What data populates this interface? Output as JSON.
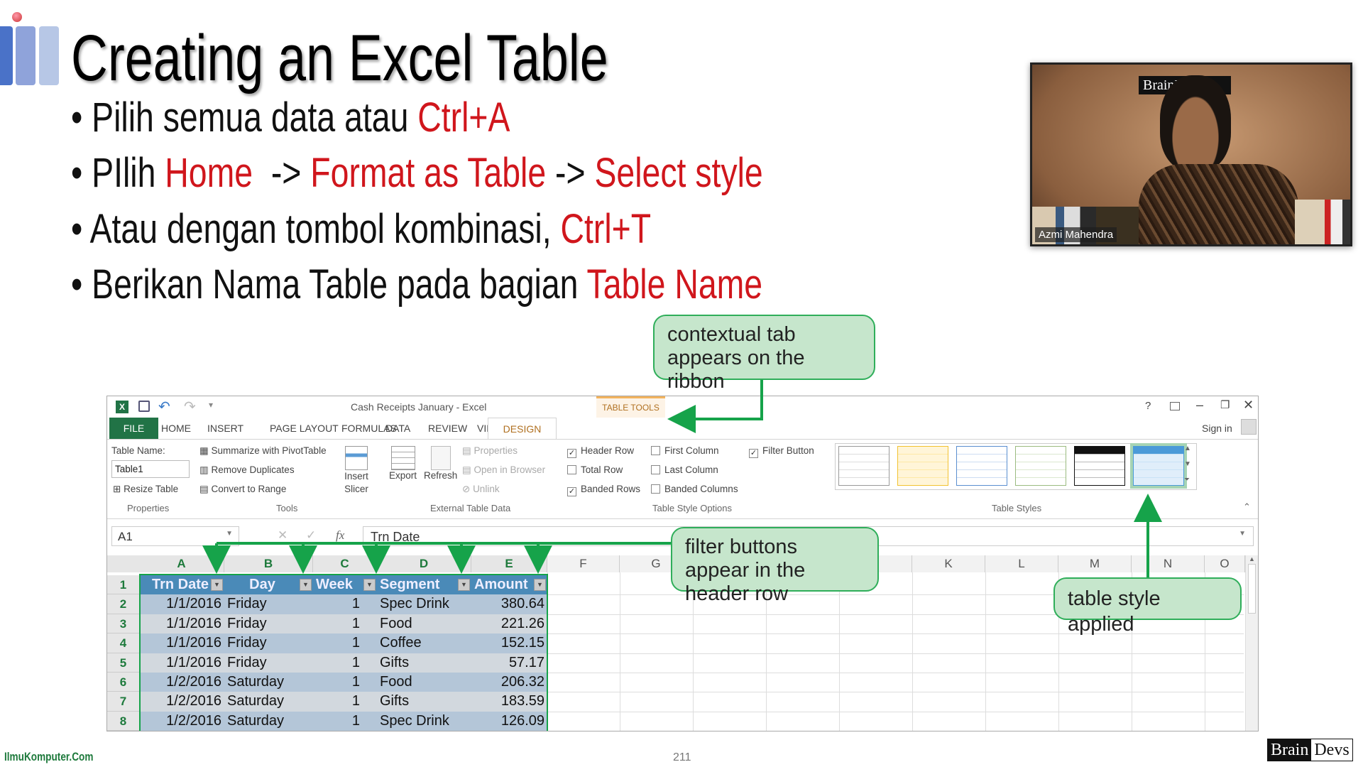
{
  "slide": {
    "title": "Creating an Excel Table",
    "bullets": [
      {
        "pre": "Pilih semua data atau ",
        "hl": "Ctrl+A",
        "mid": "",
        "hl2": "",
        "mid2": "",
        "hl3": ""
      },
      {
        "pre": "PIlih ",
        "hl": "Home",
        "mid": "  -> ",
        "hl2": "Format as Table",
        "mid2": " -> ",
        "hl3": "Select style"
      },
      {
        "pre": "Atau dengan tombol kombinasi, ",
        "hl": "Ctrl+T",
        "mid": "",
        "hl2": "",
        "mid2": "",
        "hl3": ""
      },
      {
        "pre": "Berikan Nama Table pada bagian ",
        "hl": "Table Name",
        "mid": "",
        "hl2": "",
        "mid2": "",
        "hl3": ""
      }
    ],
    "highlight_color": "#d0161c",
    "page_number": "211",
    "footer_left": "IlmuKomputer.Com",
    "footer_logo": "BrainDevs"
  },
  "webcam": {
    "participant": "Azmi Mahendra",
    "backdrop_logo": "BrainDevs"
  },
  "callouts": {
    "contextual": "contextual tab appears on the ribbon",
    "filter": "filter buttons appear in the header row",
    "style": "table style applied"
  },
  "excel": {
    "window_title": "Cash Receipts January - Excel",
    "context_group": "TABLE TOOLS",
    "help": "?",
    "sign_in": "Sign in",
    "tabs": [
      "FILE",
      "HOME",
      "INSERT",
      "PAGE LAYOUT",
      "FORMULAS",
      "DATA",
      "REVIEW",
      "VIEW",
      "DESIGN"
    ],
    "ribbon": {
      "table_name_label": "Table Name:",
      "table_name_value": "Table1",
      "resize": "Resize Table",
      "properties_group": "Properties",
      "summarize": "Summarize with PivotTable",
      "remove_dup": "Remove Duplicates",
      "convert": "Convert to Range",
      "insert_slicer": "Insert Slicer",
      "tools_group": "Tools",
      "export": "Export",
      "refresh": "Refresh",
      "properties": "Properties",
      "open_browser": "Open in Browser",
      "unlink": "Unlink",
      "external_group": "External Table Data",
      "options": [
        {
          "label": "Header Row",
          "checked": true
        },
        {
          "label": "Total Row",
          "checked": false
        },
        {
          "label": "Banded Rows",
          "checked": true
        },
        {
          "label": "First Column",
          "checked": false
        },
        {
          "label": "Last Column",
          "checked": false
        },
        {
          "label": "Banded Columns",
          "checked": false
        },
        {
          "label": "Filter Button",
          "checked": true
        }
      ],
      "options_group": "Table Style Options",
      "styles_group": "Table Styles"
    },
    "name_box": "A1",
    "formula": "Trn Date",
    "fx": "fx",
    "columns": [
      "A",
      "B",
      "C",
      "D",
      "E",
      "F",
      "G",
      "K",
      "L",
      "M",
      "N",
      "O"
    ],
    "headers": [
      "Trn Date",
      "Day",
      "Week",
      "Segment",
      "Amount"
    ],
    "rows": [
      [
        "1/1/2016",
        "Friday",
        "1",
        "Spec Drink",
        "380.64"
      ],
      [
        "1/1/2016",
        "Friday",
        "1",
        "Food",
        "221.26"
      ],
      [
        "1/1/2016",
        "Friday",
        "1",
        "Coffee",
        "152.15"
      ],
      [
        "1/1/2016",
        "Friday",
        "1",
        "Gifts",
        "57.17"
      ],
      [
        "1/2/2016",
        "Saturday",
        "1",
        "Food",
        "206.32"
      ],
      [
        "1/2/2016",
        "Saturday",
        "1",
        "Gifts",
        "183.59"
      ],
      [
        "1/2/2016",
        "Saturday",
        "1",
        "Spec Drink",
        "126.09"
      ]
    ],
    "row_numbers": [
      "1",
      "2",
      "3",
      "4",
      "5",
      "6",
      "7",
      "8"
    ],
    "colors": {
      "file_tab": "#217346",
      "table_header": "#4a8ab8",
      "band_dark": "#b4c6d8",
      "band_light": "#d2d8de",
      "context": "#c07a1a"
    }
  }
}
